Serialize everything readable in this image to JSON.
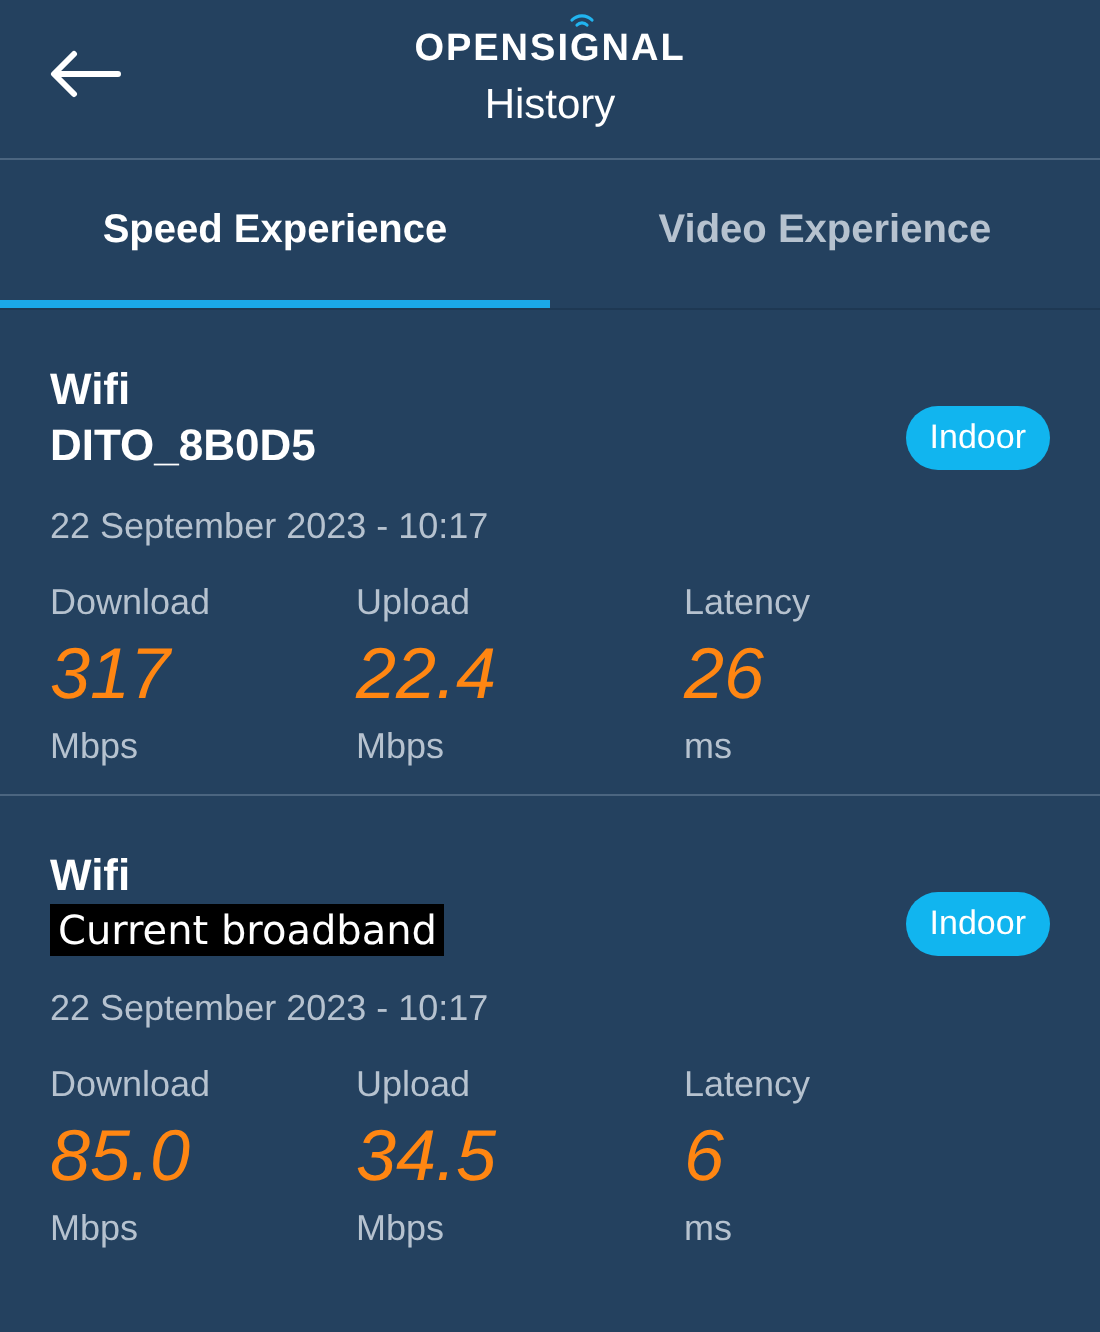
{
  "header": {
    "logo": "OPENSIGNAL",
    "title": "History"
  },
  "tabs": [
    {
      "label": "Speed Experience",
      "selected": true
    },
    {
      "label": "Video Experience",
      "selected": false
    }
  ],
  "results": [
    {
      "network_type": "Wifi",
      "network_name": {
        "text": "DITO_8B0D5",
        "kind": "plain"
      },
      "badge": "Indoor",
      "date": "22 September 2023 - 10:17",
      "metrics": [
        {
          "label": "Download",
          "value": "317",
          "unit": "Mbps"
        },
        {
          "label": "Upload",
          "value": "22.4",
          "unit": "Mbps"
        },
        {
          "label": "Latency",
          "value": "26",
          "unit": "ms"
        }
      ]
    },
    {
      "network_type": "Wifi",
      "network_name": {
        "text": "Current broadband",
        "kind": "boxed"
      },
      "badge": "Indoor",
      "date": "22 September 2023 - 10:17",
      "metrics": [
        {
          "label": "Download",
          "value": "85.0",
          "unit": "Mbps"
        },
        {
          "label": "Upload",
          "value": "34.5",
          "unit": "Mbps"
        },
        {
          "label": "Latency",
          "value": "6",
          "unit": "ms"
        }
      ]
    }
  ]
}
